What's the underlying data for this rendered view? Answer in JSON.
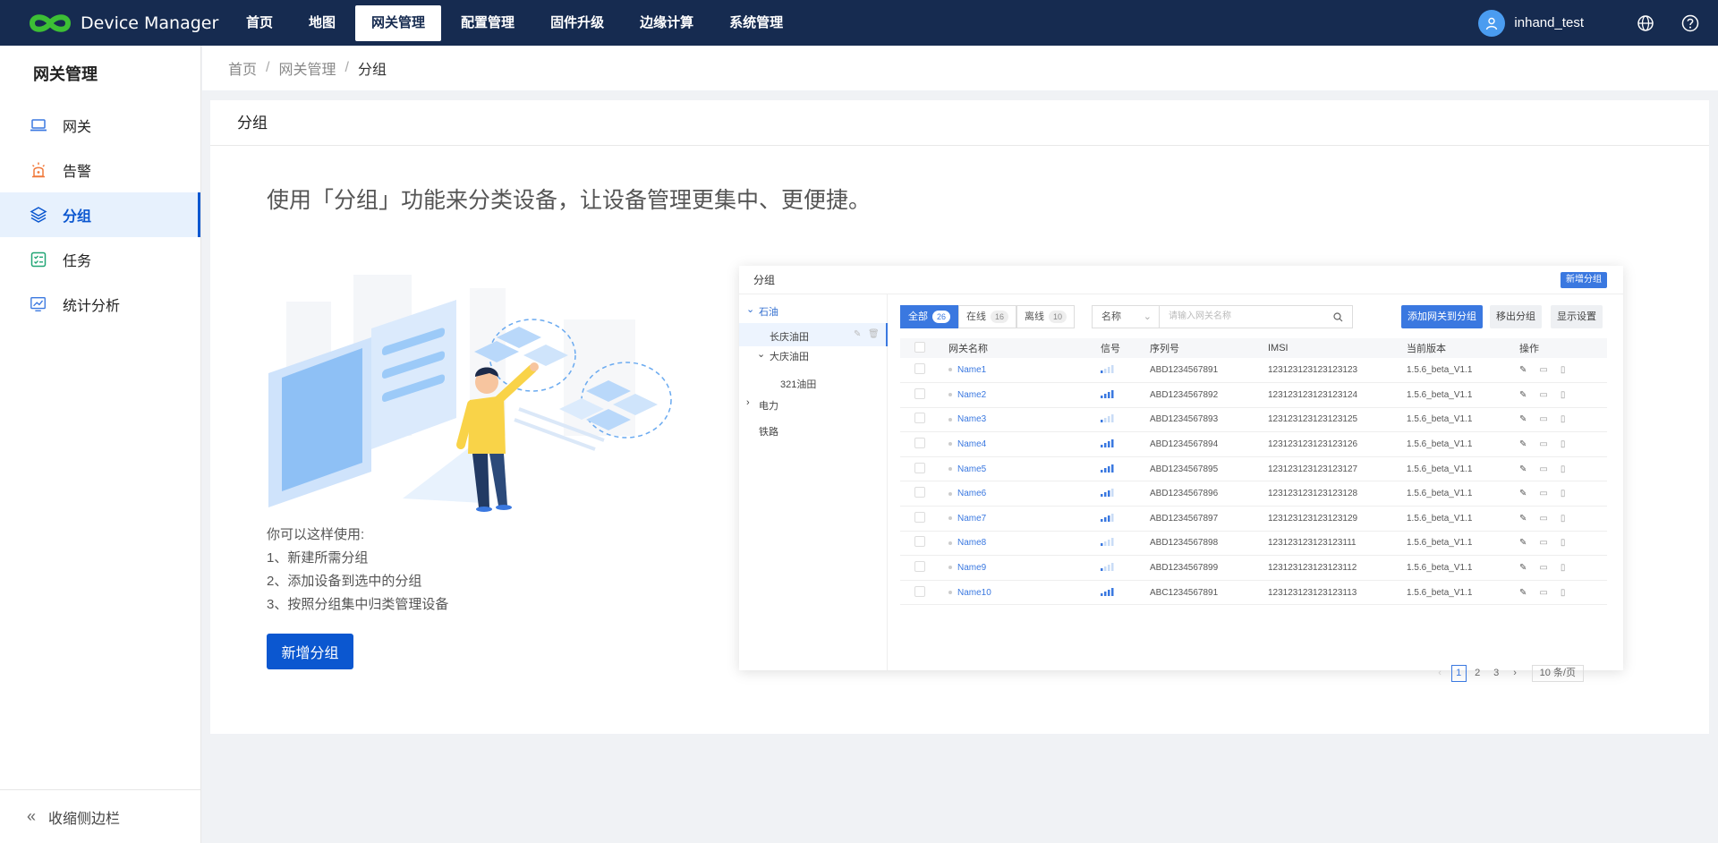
{
  "app": {
    "title": "Device Manager"
  },
  "nav": {
    "items": [
      {
        "label": "首页"
      },
      {
        "label": "地图"
      },
      {
        "label": "网关管理"
      },
      {
        "label": "配置管理"
      },
      {
        "label": "固件升级"
      },
      {
        "label": "边缘计算"
      },
      {
        "label": "系统管理"
      }
    ],
    "active": "网关管理"
  },
  "user": {
    "name": "inhand_test"
  },
  "sidebar": {
    "title": "网关管理",
    "items": [
      {
        "label": "网关",
        "icon": "laptop-icon"
      },
      {
        "label": "告警",
        "icon": "alarm-icon"
      },
      {
        "label": "分组",
        "icon": "layers-icon"
      },
      {
        "label": "任务",
        "icon": "task-icon"
      },
      {
        "label": "统计分析",
        "icon": "chart-icon"
      }
    ],
    "active": "分组",
    "collapse_label": "收缩侧边栏"
  },
  "breadcrumb": {
    "items": [
      "首页",
      "网关管理",
      "分组"
    ]
  },
  "card": {
    "title": "分组",
    "headline": "使用「分组」功能来分类设备，让设备管理更集中、更便捷。",
    "usage": {
      "intro": "你可以这样使用:",
      "steps": [
        "1、新建所需分组",
        "2、添加设备到选中的分组",
        "3、按照分组集中归类管理设备"
      ]
    },
    "button_label": "新增分组"
  },
  "preview": {
    "title": "分组",
    "add_button": "新增分组",
    "tree": {
      "nodes": [
        {
          "label": "石油"
        },
        {
          "label": "长庆油田"
        },
        {
          "label": "大庆油田"
        },
        {
          "label": "321油田"
        },
        {
          "label": "电力"
        },
        {
          "label": "铁路"
        }
      ]
    },
    "tabs": [
      {
        "label": "全部",
        "count": "26"
      },
      {
        "label": "在线",
        "count": "16"
      },
      {
        "label": "离线",
        "count": "10"
      }
    ],
    "filter": {
      "field": "名称",
      "placeholder": "请输入网关名称"
    },
    "actions": {
      "add_to_group": "添加网关到分组",
      "remove": "移出分组",
      "display": "显示设置"
    },
    "columns": [
      "网关名称",
      "信号",
      "序列号",
      "IMSI",
      "当前版本",
      "操作"
    ],
    "rows": [
      {
        "name": "Name1",
        "signal": 1,
        "serial": "ABD1234567891",
        "imsi": "123123123123123123",
        "version": "1.5.6_beta_V1.1"
      },
      {
        "name": "Name2",
        "signal": 4,
        "serial": "ABD1234567892",
        "imsi": "123123123123123124",
        "version": "1.5.6_beta_V1.1"
      },
      {
        "name": "Name3",
        "signal": 1,
        "serial": "ABD1234567893",
        "imsi": "123123123123123125",
        "version": "1.5.6_beta_V1.1"
      },
      {
        "name": "Name4",
        "signal": 4,
        "serial": "ABD1234567894",
        "imsi": "123123123123123126",
        "version": "1.5.6_beta_V1.1"
      },
      {
        "name": "Name5",
        "signal": 4,
        "serial": "ABD1234567895",
        "imsi": "123123123123123127",
        "version": "1.5.6_beta_V1.1"
      },
      {
        "name": "Name6",
        "signal": 3,
        "serial": "ABD1234567896",
        "imsi": "123123123123123128",
        "version": "1.5.6_beta_V1.1"
      },
      {
        "name": "Name7",
        "signal": 3,
        "serial": "ABD1234567897",
        "imsi": "123123123123123129",
        "version": "1.5.6_beta_V1.1"
      },
      {
        "name": "Name8",
        "signal": 1,
        "serial": "ABD1234567898",
        "imsi": "123123123123123111",
        "version": "1.5.6_beta_V1.1"
      },
      {
        "name": "Name9",
        "signal": 1,
        "serial": "ABD1234567899",
        "imsi": "123123123123123112",
        "version": "1.5.6_beta_V1.1"
      },
      {
        "name": "Name10",
        "signal": 4,
        "serial": "ABC1234567891",
        "imsi": "123123123123123113",
        "version": "1.5.6_beta_V1.1"
      }
    ],
    "pager": {
      "pages": [
        "1",
        "2",
        "3"
      ],
      "current": "1",
      "size": "10 条/页"
    }
  },
  "colors": {
    "nav_bg": "#162b50",
    "primary": "#0b57d0",
    "accent": "#3a78e0",
    "logo": "#3dbf35"
  }
}
